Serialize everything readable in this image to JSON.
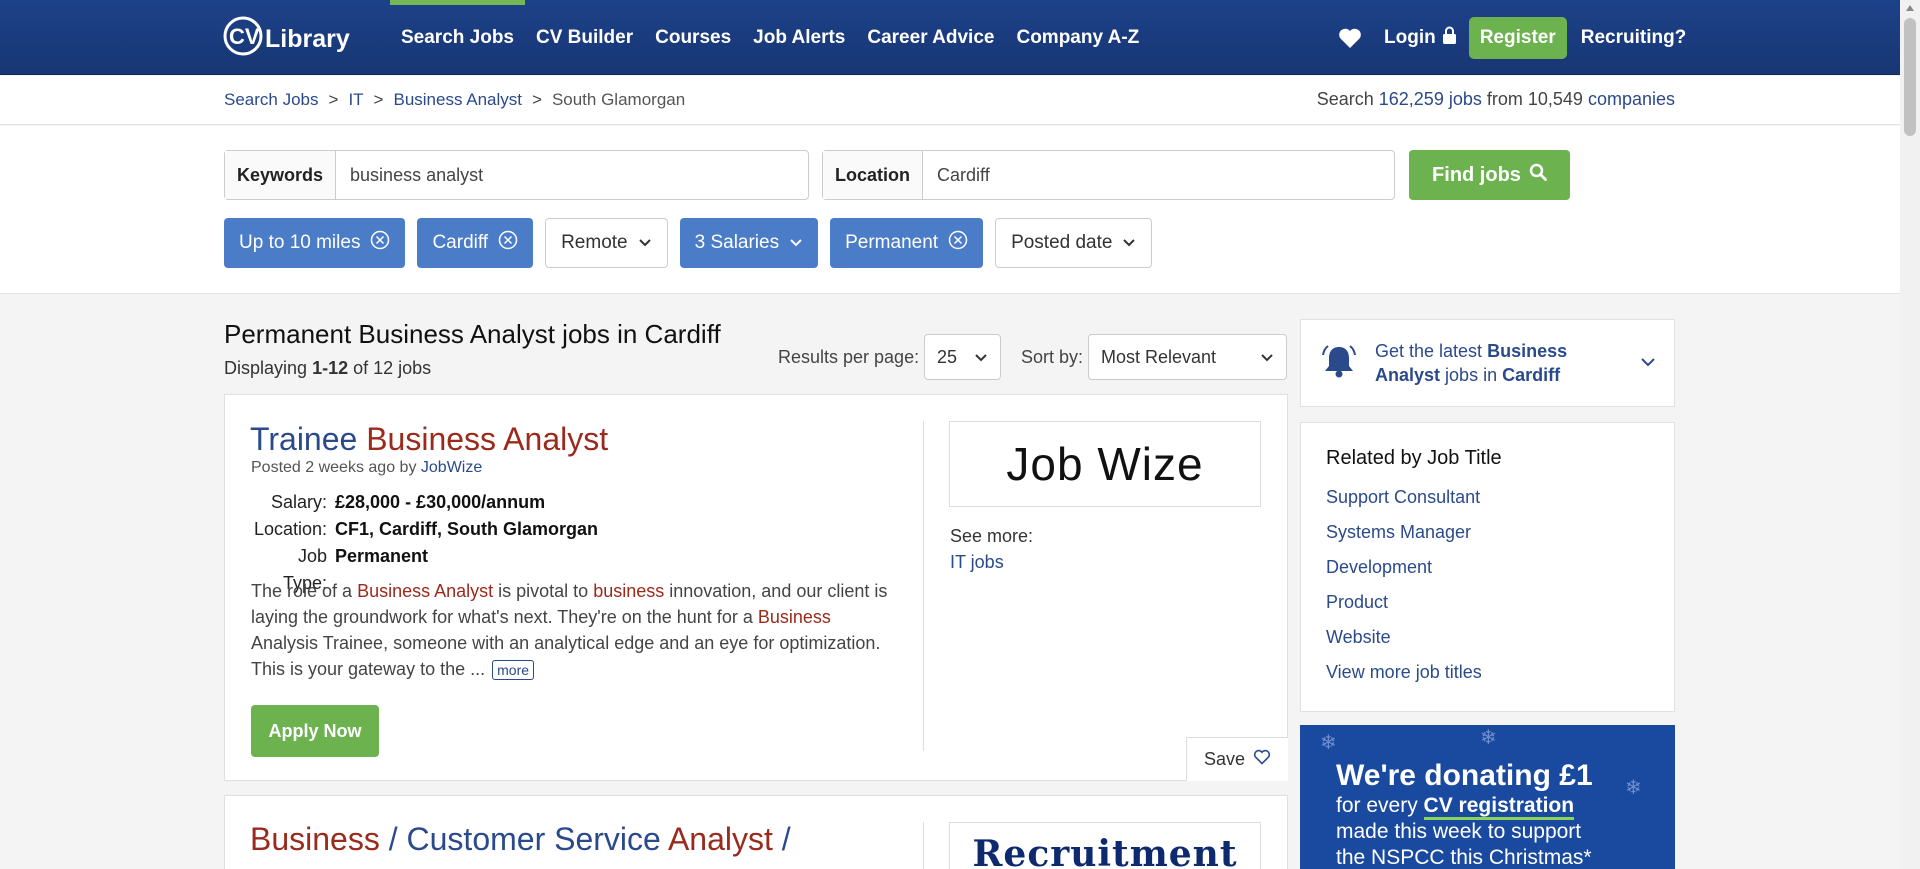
{
  "header": {
    "logo_text": "CV Library",
    "nav": [
      "Search Jobs",
      "CV Builder",
      "Courses",
      "Job Alerts",
      "Career Advice",
      "Company A-Z"
    ],
    "login": "Login",
    "register": "Register",
    "recruiting": "Recruiting?"
  },
  "breadcrumb": {
    "items": [
      "Search Jobs",
      "IT",
      "Business Analyst"
    ],
    "current": "South Glamorgan",
    "separator": ">"
  },
  "stats": {
    "prefix": "Search",
    "jobs": "162,259 jobs",
    "middle": "from 10,549",
    "companies": "companies"
  },
  "search": {
    "keywords_label": "Keywords",
    "keywords_value": "business analyst",
    "location_label": "Location",
    "location_value": "Cardiff",
    "find_button": "Find jobs"
  },
  "filters": [
    {
      "label": "Up to 10 miles",
      "active": true,
      "icon": "close-circle-icon"
    },
    {
      "label": "Cardiff",
      "active": true,
      "icon": "close-circle-icon"
    },
    {
      "label": "Remote",
      "active": false,
      "icon": "chevron-down-icon"
    },
    {
      "label": "3 Salaries",
      "active": true,
      "icon": "chevron-down-icon"
    },
    {
      "label": "Permanent",
      "active": true,
      "icon": "close-circle-icon"
    },
    {
      "label": "Posted date",
      "active": false,
      "icon": "chevron-down-icon"
    }
  ],
  "results": {
    "title": "Permanent Business Analyst jobs in Cardiff",
    "count_prefix": "Displaying",
    "count_range": "1-12",
    "count_suffix": "of 12 jobs",
    "per_page_label": "Results per page:",
    "per_page_value": "25",
    "sort_label": "Sort by:",
    "sort_value": "Most Relevant"
  },
  "jobs": [
    {
      "title_parts": [
        {
          "t": "Trainee ",
          "hl": false
        },
        {
          "t": "Business Analyst",
          "hl": true
        }
      ],
      "posted_prefix": "Posted 2 weeks ago by",
      "company": "JobWize",
      "salary_label": "Salary:",
      "salary": "£28,000 - £30,000/annum",
      "location_label": "Location:",
      "location": "CF1, Cardiff, South Glamorgan",
      "type_label": "Job Type:",
      "type": "Permanent",
      "desc_parts": [
        {
          "t": "The role of a ",
          "hl": false
        },
        {
          "t": "Business Analyst",
          "hl": true
        },
        {
          "t": " is pivotal to ",
          "hl": false
        },
        {
          "t": "business",
          "hl": true
        },
        {
          "t": " innovation, and our client is laying the groundwork for what's next. They're on the hunt for a ",
          "hl": false
        },
        {
          "t": "Business",
          "hl": true
        },
        {
          "t": " Analysis Trainee, someone with an analytical edge and an eye for optimization. This is your gateway to the ...",
          "hl": false
        }
      ],
      "more": "more",
      "apply": "Apply Now",
      "logo_text": "Job Wize",
      "see_more_label": "See more:",
      "see_more_link": "IT jobs",
      "save": "Save"
    },
    {
      "title_parts": [
        {
          "t": "Business",
          "hl": true
        },
        {
          "t": " / Customer Service ",
          "hl": false
        },
        {
          "t": "Analyst",
          "hl": true
        },
        {
          "t": " /",
          "hl": false
        }
      ],
      "logo_text": "Recruitment"
    }
  ],
  "sidebar": {
    "alert_prefix": "Get the latest",
    "alert_job": "Business Analyst",
    "alert_middle": "jobs in",
    "alert_location": "Cardiff",
    "related_title": "Related by Job Title",
    "related": [
      "Support Consultant",
      "Systems Manager",
      "Development",
      "Product",
      "Website",
      "View more job titles"
    ],
    "promo_line1": "We're donating £1",
    "promo_line2_prefix": "for every",
    "promo_line2_link": "CV registration",
    "promo_line3": "made this week to support",
    "promo_line4": "the NSPCC this Christmas*"
  },
  "colors": {
    "header_bg": "#1d4189",
    "accent_green": "#6cb24f",
    "chip_active": "#4a7cc7",
    "link": "#2b4a8b",
    "highlight": "#9a2a1c"
  }
}
